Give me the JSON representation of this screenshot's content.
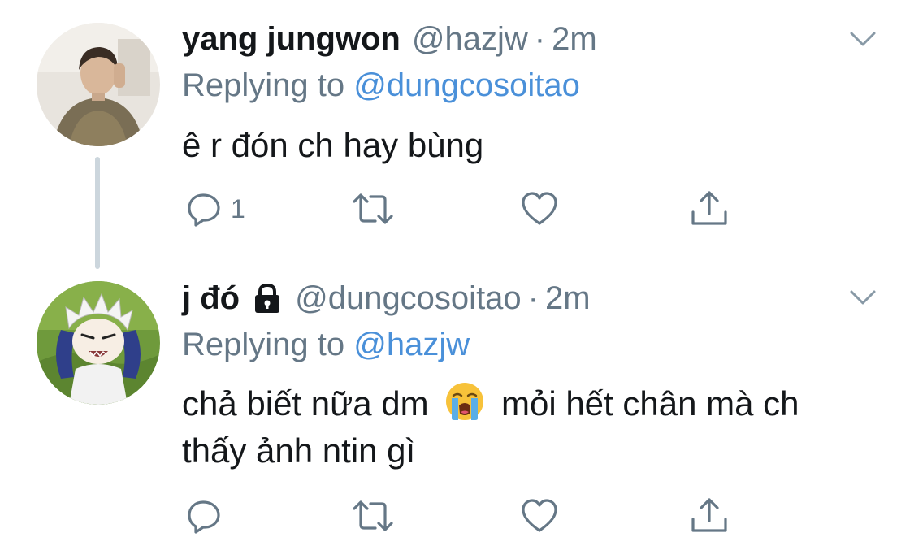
{
  "tweets": [
    {
      "display_name": "yang jungwon",
      "handle": "@hazjw",
      "separator": "·",
      "time": "2m",
      "replying_prefix": "Replying to",
      "replying_handle": "@dungcosoitao",
      "text_lines": [
        "ê r đón ch hay bùng"
      ],
      "reply_count": "1",
      "protected": false
    },
    {
      "display_name": "j đó",
      "handle": "@dungcosoitao",
      "separator": "·",
      "time": "2m",
      "replying_prefix": "Replying to",
      "replying_handle": "@hazjw",
      "text_line1_before": "chả biết nữa dm",
      "text_line1_after": "mỏi hết chân mà ch",
      "text_line2": "thấy ảnh ntin gì",
      "reply_count": "",
      "protected": true,
      "emoji": "loudly-crying-face"
    }
  ],
  "icons": {
    "reply": "reply-icon",
    "retweet": "retweet-icon",
    "like": "heart-icon",
    "share": "share-icon",
    "caret": "chevron-down-icon",
    "lock": "lock-icon"
  },
  "colors": {
    "text": "#14171a",
    "secondary": "#657786",
    "link": "#4a90d9",
    "thread_line": "#ccd6dd"
  }
}
